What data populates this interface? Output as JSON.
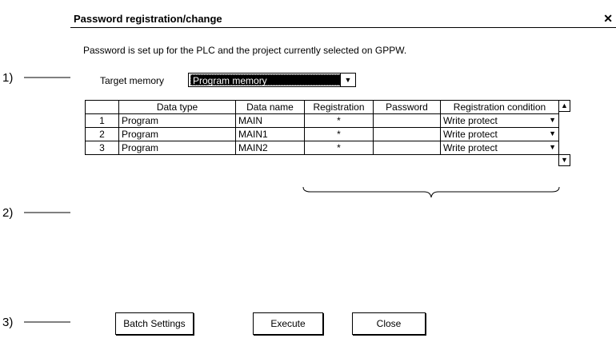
{
  "dialog": {
    "title": "Password registration/change",
    "close_glyph": "✕",
    "description": "Password is set up for the PLC and the project currently selected on GPPW.",
    "target_memory_label": "Target memory",
    "target_memory_value": "Program memory"
  },
  "table": {
    "headers": [
      "",
      "Data type",
      "Data name",
      "Registration",
      "Password",
      "Registration condition"
    ],
    "rows": [
      {
        "no": "1",
        "type": "Program",
        "name": "MAIN",
        "reg": "*",
        "pw": "",
        "cond": "Write protect"
      },
      {
        "no": "2",
        "type": "Program",
        "name": "MAIN1",
        "reg": "*",
        "pw": "",
        "cond": "Write protect"
      },
      {
        "no": "3",
        "type": "Program",
        "name": "MAIN2",
        "reg": "*",
        "pw": "",
        "cond": "Write protect"
      }
    ]
  },
  "buttons": {
    "batch": "Batch Settings",
    "execute": "Execute",
    "close": "Close"
  },
  "callouts": {
    "one": "1)",
    "two": "2)",
    "three": "3)"
  },
  "icons": {
    "dropdown": "chevron-down-icon",
    "scroll_up": "arrow-up-icon",
    "scroll_down": "arrow-down-icon"
  }
}
